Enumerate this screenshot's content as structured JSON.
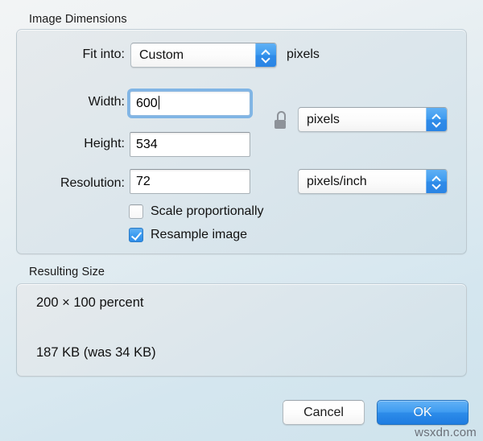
{
  "sections": {
    "image_dimensions": {
      "title": "Image Dimensions",
      "fit_into": {
        "label": "Fit into:",
        "selected": "Custom",
        "unit_suffix": "pixels"
      },
      "width": {
        "label": "Width:",
        "value": "600",
        "focused": true
      },
      "height": {
        "label": "Height:",
        "value": "534"
      },
      "resolution": {
        "label": "Resolution:",
        "value": "72"
      },
      "size_unit": {
        "selected": "pixels"
      },
      "resolution_unit": {
        "selected": "pixels/inch"
      },
      "lock_icon": "unlocked-padlock-icon",
      "checkboxes": [
        {
          "label": "Scale proportionally",
          "checked": false
        },
        {
          "label": "Resample image",
          "checked": true
        }
      ]
    },
    "resulting_size": {
      "title": "Resulting Size",
      "percent_line": "200 × 100 percent",
      "filesize_line": "187 KB (was 34 KB)"
    }
  },
  "buttons": {
    "cancel": "Cancel",
    "ok": "OK"
  },
  "watermark": "wsxdn.com",
  "colors": {
    "accent_blue": "#2d8ce9",
    "focus_ring": "#70ace4",
    "panel_bg": "#dbe6ec",
    "lock_gray": "#8d9299"
  }
}
